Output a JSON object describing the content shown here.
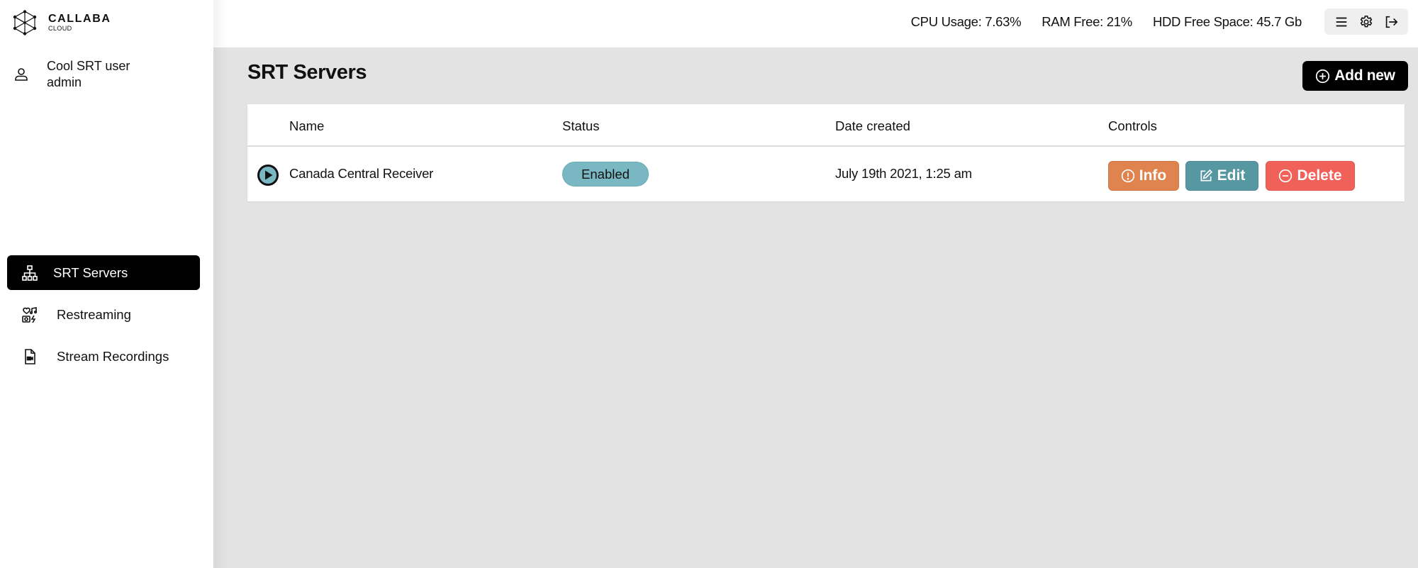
{
  "app": {
    "logo_main": "CALLABA",
    "logo_sub": "CLOUD"
  },
  "user": {
    "name": "Cool SRT user",
    "role": "admin",
    "icon": "user-icon"
  },
  "sidebar": {
    "items": [
      {
        "label": "SRT Servers",
        "icon": "sitemap-icon",
        "active": true
      },
      {
        "label": "Restreaming",
        "icon": "restream-icon",
        "active": false
      },
      {
        "label": "Stream Recordings",
        "icon": "video-file-icon",
        "active": false
      }
    ]
  },
  "header": {
    "cpu": "CPU Usage: 7.63%",
    "ram": "RAM Free: 21%",
    "hdd": "HDD Free Space: 45.7 Gb",
    "tools": [
      "menu-icon",
      "gear-icon",
      "logout-icon"
    ]
  },
  "main": {
    "title": "SRT Servers",
    "add_label": "Add new",
    "table": {
      "columns": [
        "Name",
        "Status",
        "Date created",
        "Controls"
      ],
      "rows": [
        {
          "name": "Canada Central Receiver",
          "status": "Enabled",
          "date": "July 19th 2021, 1:25 am",
          "controls": {
            "info": "Info",
            "edit": "Edit",
            "delete": "Delete"
          }
        }
      ]
    }
  },
  "colors": {
    "active_nav": "#000000",
    "status_enabled": "#79b7c3",
    "info": "#e0844f",
    "edit": "#5797a1",
    "delete": "#f06159",
    "background": "#e3e3e3"
  }
}
